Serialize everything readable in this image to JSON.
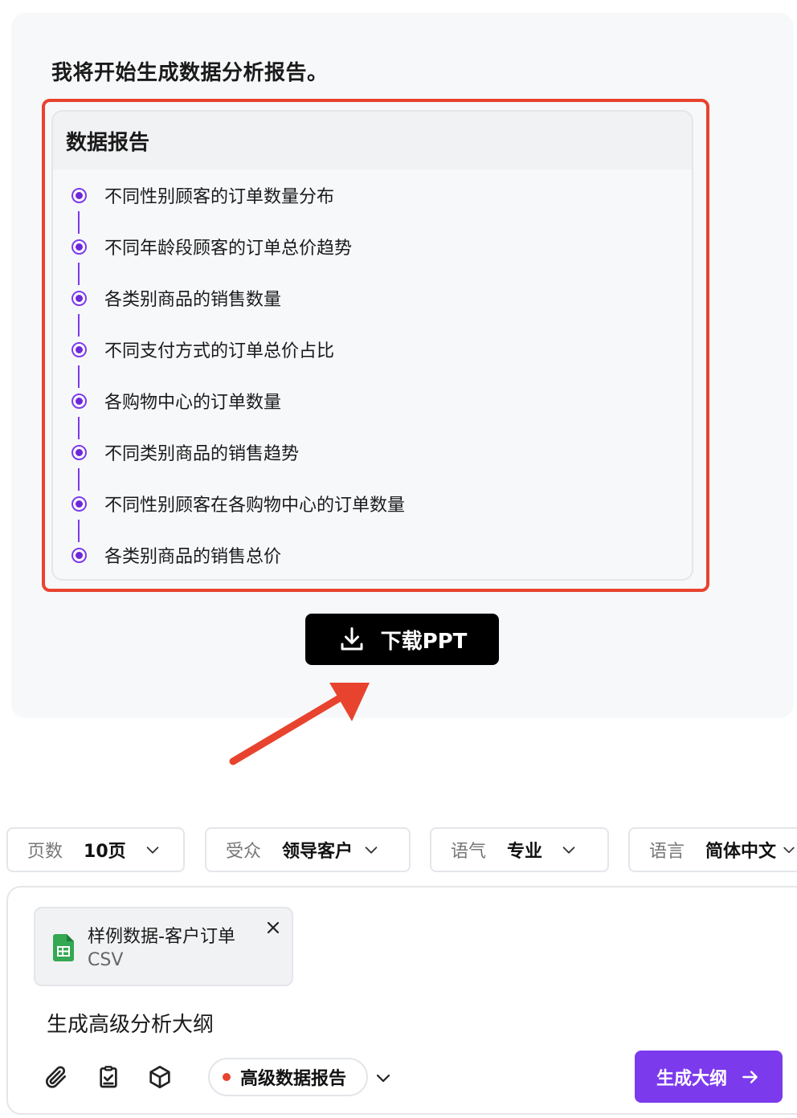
{
  "chat": {
    "intro_text": "我将开始生成数据分析报告。",
    "report": {
      "title": "数据报告",
      "items": [
        "不同性别顾客的订单数量分布",
        "不同年龄段顾客的订单总价趋势",
        "各类别商品的销售数量",
        "不同支付方式的订单总价占比",
        "各购物中心的订单数量",
        "不同类别商品的销售趋势",
        "不同性别顾客在各购物中心的订单数量",
        "各类别商品的销售总价"
      ]
    },
    "download_label": "下载PPT"
  },
  "options": {
    "pages": {
      "label": "页数",
      "value": "10页"
    },
    "audience": {
      "label": "受众",
      "value": "领导客户"
    },
    "tone": {
      "label": "语气",
      "value": "专业"
    },
    "language": {
      "label": "语言",
      "value": "简体中文"
    }
  },
  "composer": {
    "file": {
      "name": "样例数据-客户订单",
      "type": "CSV"
    },
    "prompt": "生成高级分析大纲",
    "mode_label": "高级数据报告",
    "generate_label": "生成大纲"
  },
  "colors": {
    "accent": "#7c3aed",
    "annotation": "#e8432e",
    "sheet_icon": "#34a853",
    "download_bg": "#000000"
  },
  "icons": {
    "download": "download-icon",
    "chevron": "chevron-down-icon",
    "close": "close-icon",
    "attach": "paperclip-icon",
    "task": "clipboard-check-icon",
    "cube": "cube-icon",
    "arrow": "arrow-right-icon",
    "file": "spreadsheet-icon"
  }
}
